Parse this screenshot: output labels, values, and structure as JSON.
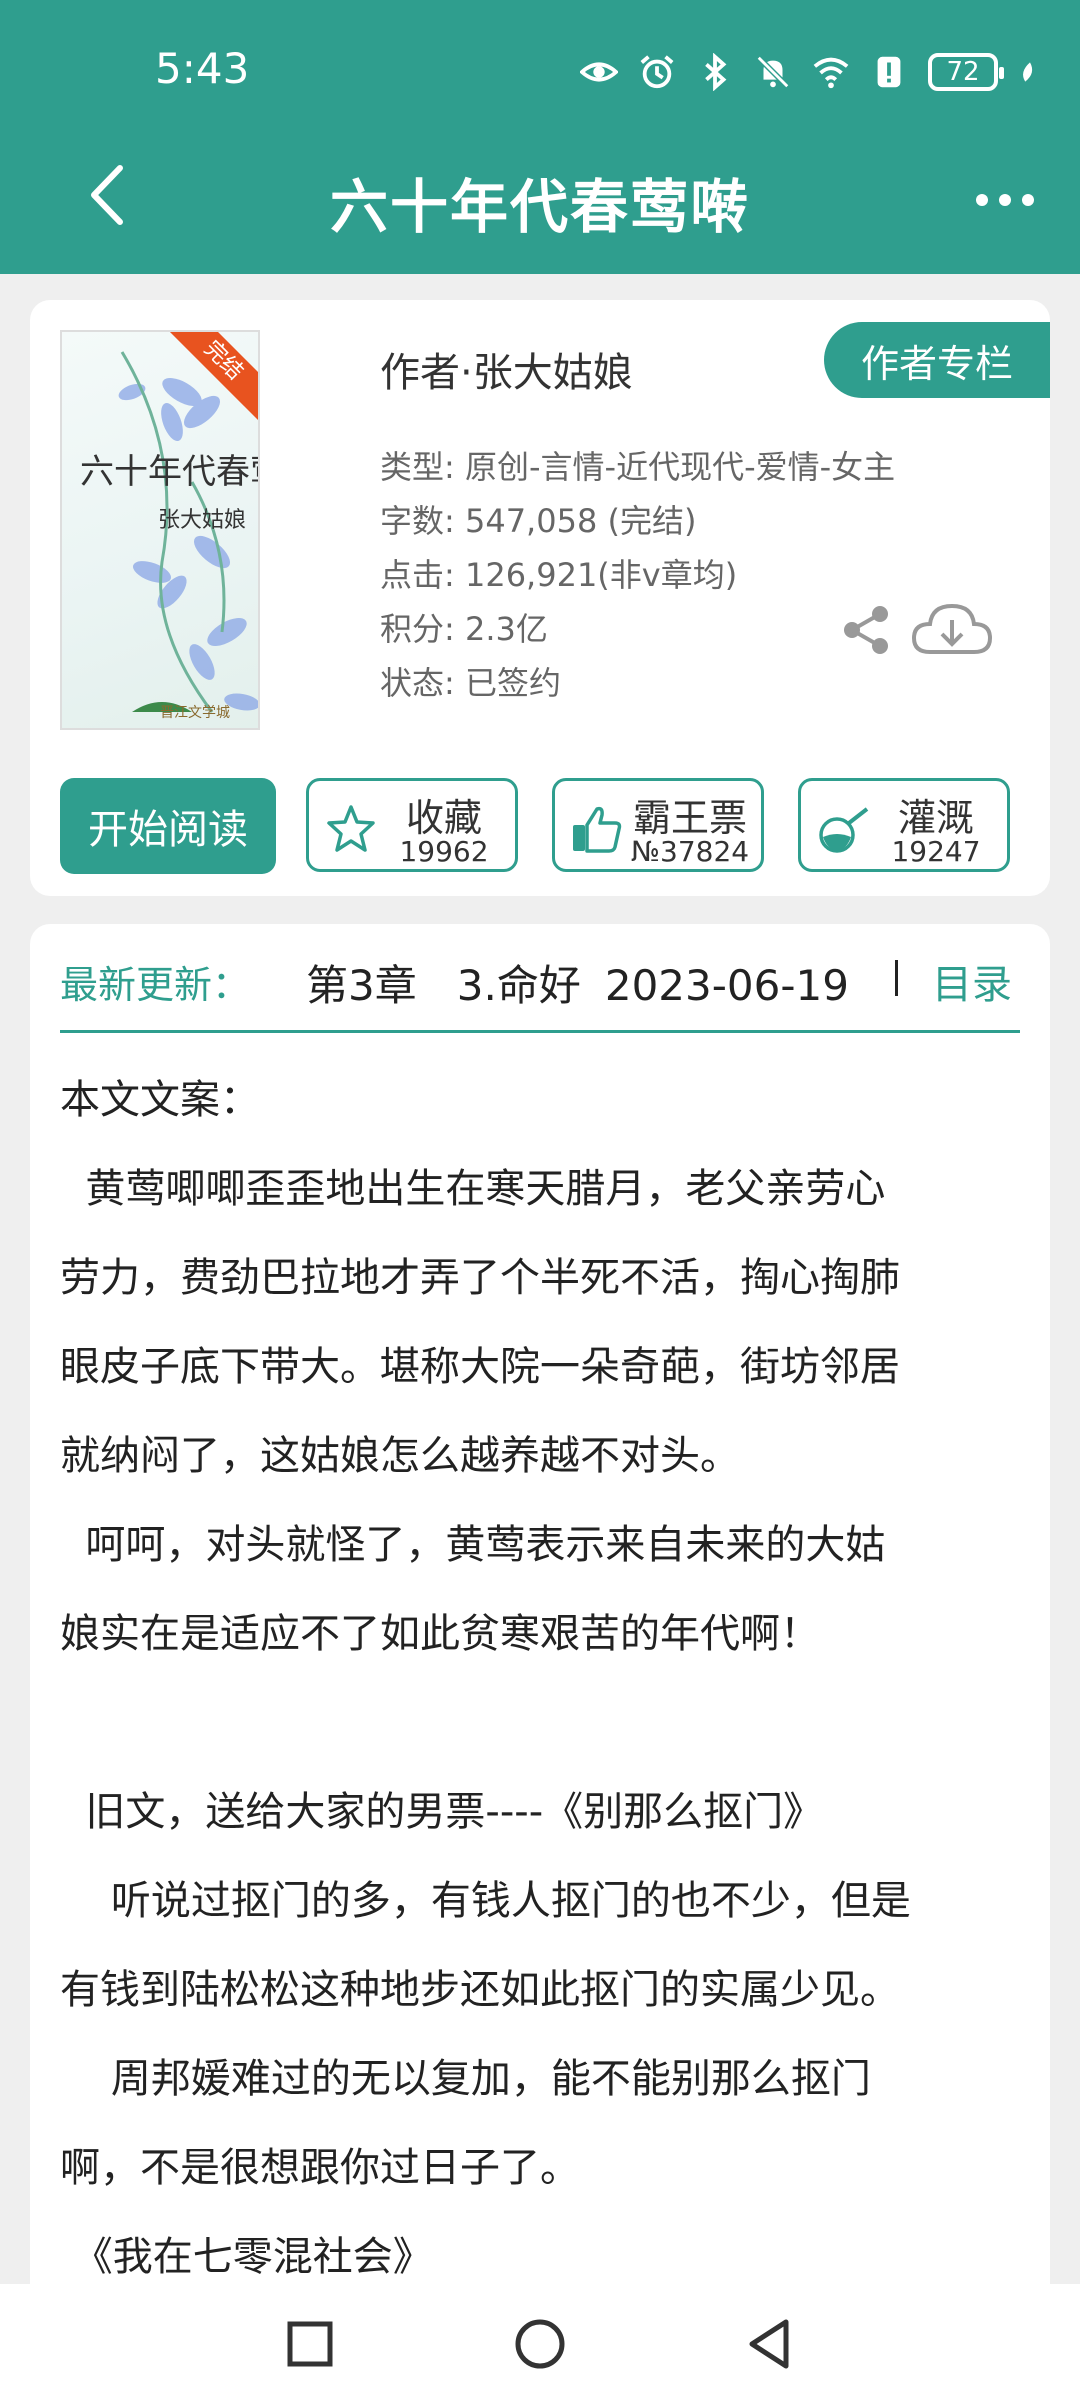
{
  "status_bar": {
    "time": "5:43",
    "battery": "72",
    "icons": [
      "eye-icon",
      "alarm-icon",
      "bluetooth-icon",
      "mute-icon",
      "wifi-icon",
      "alert-icon",
      "battery-icon",
      "leaf-icon"
    ]
  },
  "header": {
    "title": "六十年代春莺啭",
    "back_icon": "chevron-left-icon",
    "more_icon": "more-dots-icon"
  },
  "book": {
    "cover": {
      "title": "六十年代春莺啭",
      "author": "张大姑娘",
      "badge": "完结",
      "logo_text": "晋江文学城"
    },
    "author_line": "作者·张大姑娘",
    "author_column_button": "作者专栏",
    "meta": [
      {
        "key": "类型:",
        "value": "原创-言情-近代现代-爱情-女主"
      },
      {
        "key": "字数:",
        "value": "547,058 (完结)"
      },
      {
        "key": "点击:",
        "value": "126,921(非v章均)"
      },
      {
        "key": "积分:",
        "value": "2.3亿"
      },
      {
        "key": "状态:",
        "value": "已签约"
      }
    ]
  },
  "actions": {
    "start_reading": "开始阅读",
    "buttons": [
      {
        "label": "收藏",
        "count": "19962",
        "icon": "star-icon"
      },
      {
        "label": "霸王票",
        "count": "№37824",
        "icon": "thumbs-up-icon"
      },
      {
        "label": "灌溉",
        "count": "19247",
        "icon": "watering-icon"
      }
    ]
  },
  "latest_update": {
    "label": "最新更新：",
    "chapter": "第3章   3.命好",
    "date": "2023-06-19",
    "toc": "目录"
  },
  "synopsis": [
    "本文文案：",
    "  黄莺唧唧歪歪地出生在寒天腊月，老父亲劳心",
    "劳力，费劲巴拉地才弄了个半死不活，掏心掏肺",
    "眼皮子底下带大。堪称大院一朵奇葩，街坊邻居",
    "就纳闷了，这姑娘怎么越养越不对头。",
    "  呵呵，对头就怪了，黄莺表示来自未来的大姑",
    "娘实在是适应不了如此贫寒艰苦的年代啊！",
    "",
    "  旧文，送给大家的男票----《别那么抠门》",
    "    听说过抠门的多，有钱人抠门的也不少，但是",
    "有钱到陆松松这种地步还如此抠门的实属少见。",
    "    周邦媛难过的无以复加，能不能别那么抠门",
    "啊，不是很想跟你过日子了。",
    " 《我在七零混社会》"
  ],
  "nav_bar": {
    "icons": [
      "recents-square-icon",
      "home-circle-icon",
      "back-triangle-icon"
    ]
  },
  "colors": {
    "accent": "#2f9e8e",
    "badge": "#e8531f"
  }
}
